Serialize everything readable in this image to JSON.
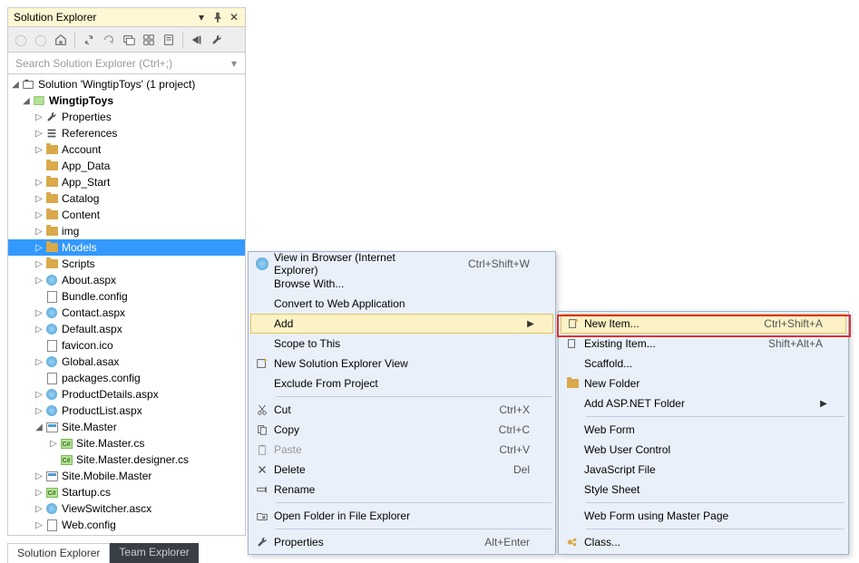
{
  "panel": {
    "title": "Solution Explorer",
    "search_placeholder": "Search Solution Explorer (Ctrl+;)"
  },
  "tree": {
    "solution": "Solution 'WingtipToys' (1 project)",
    "project": "WingtipToys",
    "items": [
      {
        "label": "Properties",
        "type": "wrench",
        "exp": true
      },
      {
        "label": "References",
        "type": "ref",
        "exp": true
      },
      {
        "label": "Account",
        "type": "folder",
        "exp": true
      },
      {
        "label": "App_Data",
        "type": "folder",
        "exp": false
      },
      {
        "label": "App_Start",
        "type": "folder",
        "exp": true
      },
      {
        "label": "Catalog",
        "type": "folder",
        "exp": true
      },
      {
        "label": "Content",
        "type": "folder",
        "exp": true
      },
      {
        "label": "img",
        "type": "folder",
        "exp": true
      },
      {
        "label": "Models",
        "type": "folder",
        "exp": true,
        "selected": true
      },
      {
        "label": "Scripts",
        "type": "folder",
        "exp": true
      },
      {
        "label": "About.aspx",
        "type": "aspx",
        "exp": true
      },
      {
        "label": "Bundle.config",
        "type": "config",
        "exp": false
      },
      {
        "label": "Contact.aspx",
        "type": "aspx",
        "exp": true
      },
      {
        "label": "Default.aspx",
        "type": "aspx",
        "exp": true
      },
      {
        "label": "favicon.ico",
        "type": "file",
        "exp": false
      },
      {
        "label": "Global.asax",
        "type": "aspx",
        "exp": true
      },
      {
        "label": "packages.config",
        "type": "config",
        "exp": false
      },
      {
        "label": "ProductDetails.aspx",
        "type": "aspx",
        "exp": true
      },
      {
        "label": "ProductList.aspx",
        "type": "aspx",
        "exp": true
      },
      {
        "label": "Site.Master",
        "type": "master",
        "exp": true,
        "open": true
      },
      {
        "label": "Site.Master.cs",
        "type": "cs",
        "exp": true,
        "indent": 1
      },
      {
        "label": "Site.Master.designer.cs",
        "type": "cs",
        "exp": false,
        "indent": 1
      },
      {
        "label": "Site.Mobile.Master",
        "type": "master",
        "exp": true
      },
      {
        "label": "Startup.cs",
        "type": "cs",
        "exp": true
      },
      {
        "label": "ViewSwitcher.ascx",
        "type": "aspx",
        "exp": true
      },
      {
        "label": "Web.config",
        "type": "config",
        "exp": true
      }
    ]
  },
  "tabs": {
    "active": "Solution Explorer",
    "inactive": "Team Explorer"
  },
  "cm1": [
    {
      "label": "View in Browser (Internet Explorer)",
      "shortcut": "Ctrl+Shift+W",
      "icon": "globe"
    },
    {
      "label": "Browse With..."
    },
    {
      "label": "Convert to Web Application"
    },
    {
      "label": "Add",
      "arrow": true,
      "highlight": true
    },
    {
      "label": "Scope to This"
    },
    {
      "label": "New Solution Explorer View",
      "icon": "newview"
    },
    {
      "label": "Exclude From Project"
    },
    {
      "sep": true
    },
    {
      "label": "Cut",
      "shortcut": "Ctrl+X",
      "icon": "cut"
    },
    {
      "label": "Copy",
      "shortcut": "Ctrl+C",
      "icon": "copy"
    },
    {
      "label": "Paste",
      "shortcut": "Ctrl+V",
      "icon": "paste",
      "disabled": true
    },
    {
      "label": "Delete",
      "shortcut": "Del",
      "icon": "delete"
    },
    {
      "label": "Rename",
      "icon": "rename"
    },
    {
      "sep": true
    },
    {
      "label": "Open Folder in File Explorer",
      "icon": "openfolder"
    },
    {
      "sep": true
    },
    {
      "label": "Properties",
      "shortcut": "Alt+Enter",
      "icon": "props"
    }
  ],
  "cm2": [
    {
      "label": "New Item...",
      "shortcut": "Ctrl+Shift+A",
      "icon": "newitem",
      "highlight": true
    },
    {
      "label": "Existing Item...",
      "shortcut": "Shift+Alt+A",
      "icon": "existitem"
    },
    {
      "label": "Scaffold..."
    },
    {
      "label": "New Folder",
      "icon": "newfolder"
    },
    {
      "label": "Add ASP.NET Folder",
      "arrow": true
    },
    {
      "sep": true
    },
    {
      "label": "Web Form"
    },
    {
      "label": "Web User Control"
    },
    {
      "label": "JavaScript File"
    },
    {
      "label": "Style Sheet"
    },
    {
      "sep": true
    },
    {
      "label": "Web Form using Master Page"
    },
    {
      "sep": true
    },
    {
      "label": "Class...",
      "icon": "class"
    }
  ]
}
